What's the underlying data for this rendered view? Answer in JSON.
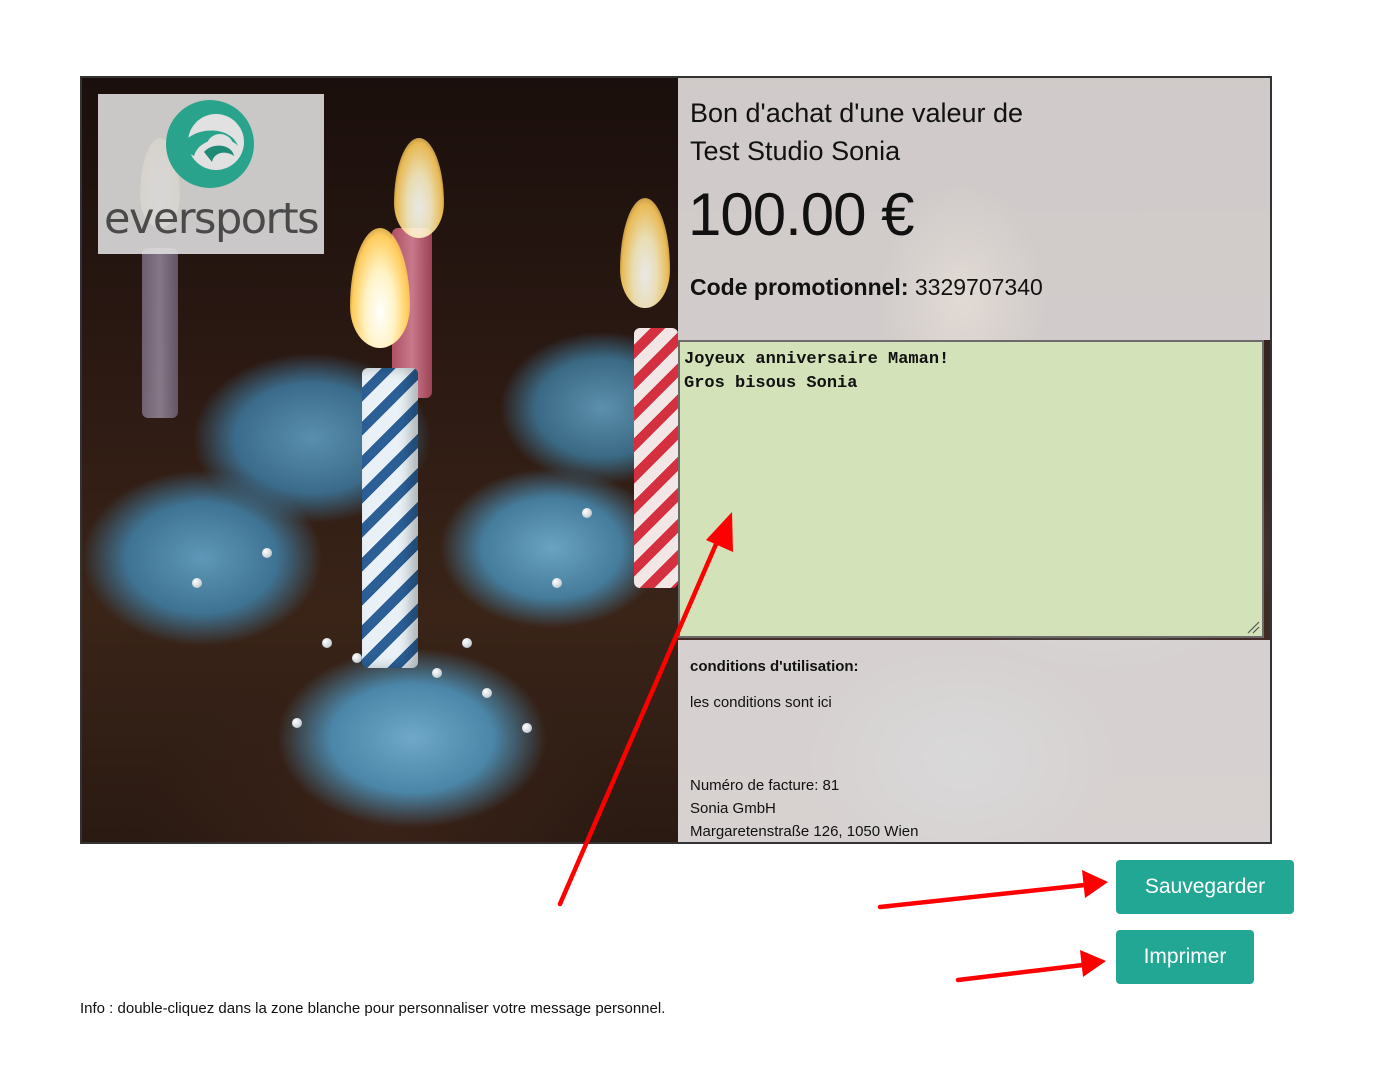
{
  "voucher": {
    "logo_text": "eversports",
    "title_line1": "Bon d'achat d'une valeur de",
    "title_line2": "Test Studio Sonia",
    "amount": "100.00 €",
    "promo_label": "Code promotionnel:",
    "promo_code": "3329707340",
    "message_line1": "Joyeux anniversaire Maman!",
    "message_line2": "Gros bisous Sonia",
    "terms_label": "conditions d'utilisation:",
    "terms_text": "les conditions sont ici",
    "invoice_number": "Numéro de facture: 81",
    "company_name": "Sonia GmbH",
    "company_address": "Margaretenstraße 126, 1050 Wien"
  },
  "actions": {
    "save_label": "Sauvegarder",
    "print_label": "Imprimer"
  },
  "footnote": "Info : double-cliquez dans la zone blanche pour personnaliser votre message personnel.",
  "colors": {
    "button": "#22a794",
    "message_bg": "#d3e2b9",
    "arrow": "#ff0000",
    "logo_teal": "#2aa38c"
  },
  "icons": {
    "logo": "eversports-swirl-icon",
    "resize": "resize-grip-icon",
    "annotation": "red-arrow-icon"
  }
}
